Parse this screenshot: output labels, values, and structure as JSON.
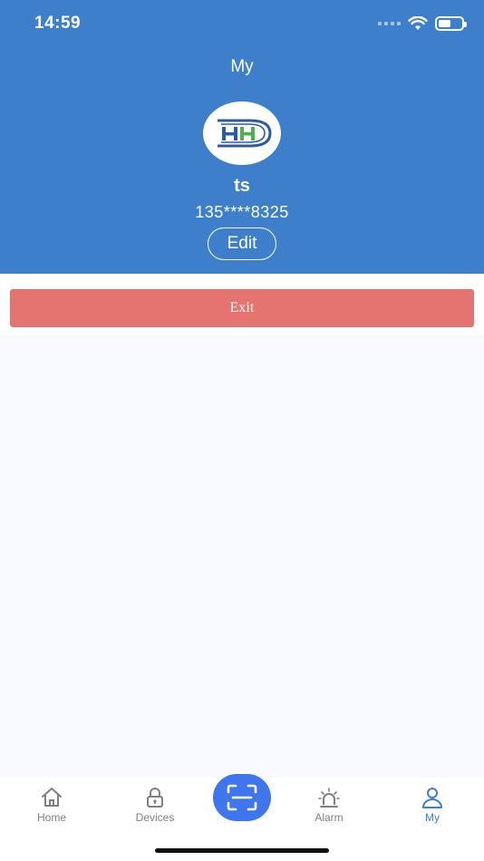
{
  "status_bar": {
    "time": "14:59"
  },
  "header": {
    "title": "My",
    "user_name": "ts",
    "phone": "135****8325",
    "edit_label": "Edit"
  },
  "exit_label": "Exit",
  "tabs": [
    {
      "label": "Home",
      "icon": "home-icon",
      "active": false
    },
    {
      "label": "Devices",
      "icon": "lock-icon",
      "active": false
    },
    {
      "label": "Alarm",
      "icon": "alarm-icon",
      "active": false
    },
    {
      "label": "My",
      "icon": "user-icon",
      "active": true
    }
  ],
  "scan_icon": "scan-icon",
  "colors": {
    "header": "#3d7fca",
    "exit": "#e57471",
    "scan": "#3f76ee",
    "active_tab": "#3d7fca",
    "inactive_tab": "#7f7f7f"
  }
}
